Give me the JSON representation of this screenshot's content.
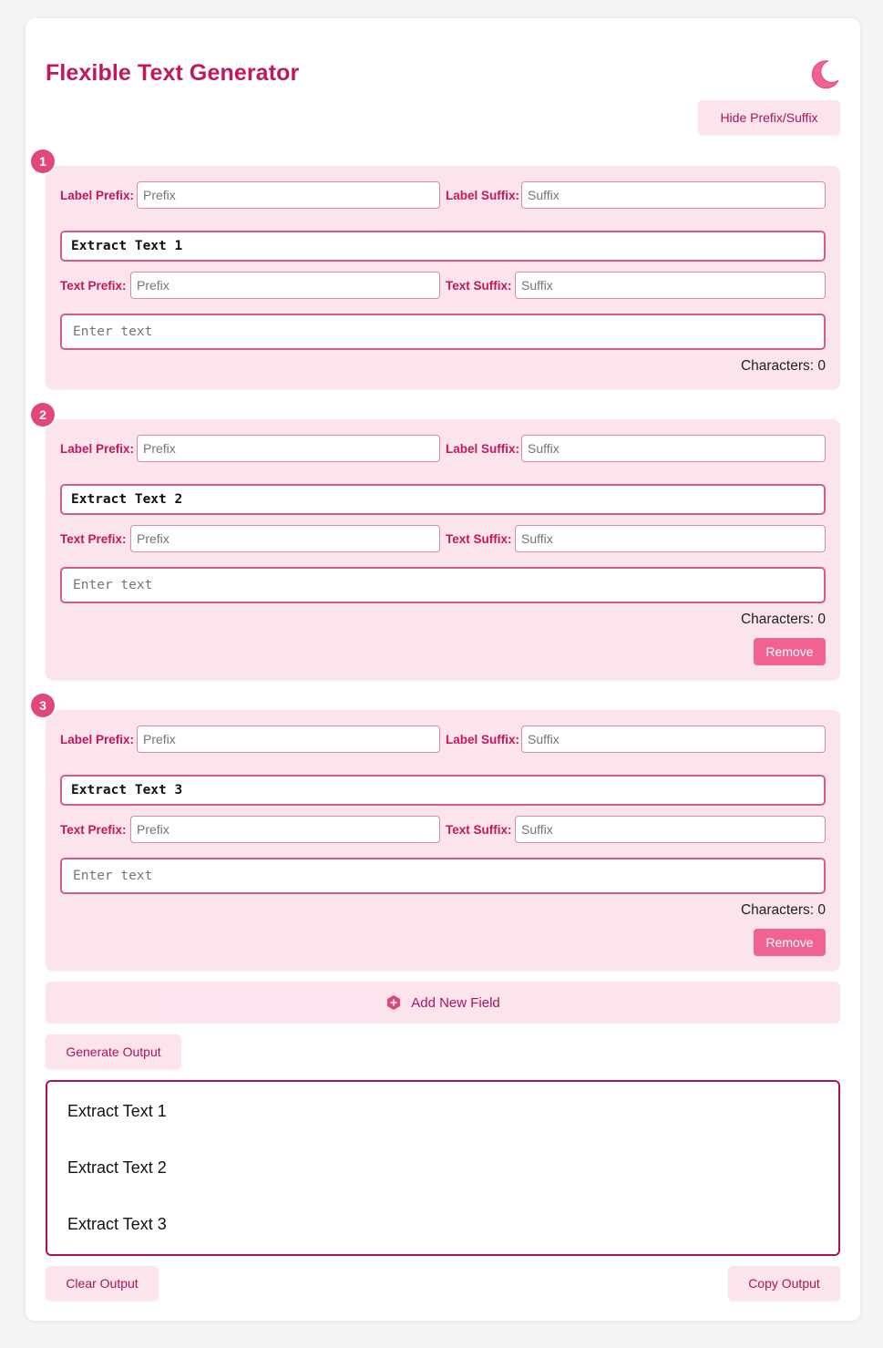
{
  "app": {
    "title": "Flexible Text Generator",
    "theme_icon": "moon-icon",
    "toggle_label": "Hide Prefix/Suffix"
  },
  "labels": {
    "label_prefix": "Label Prefix:",
    "label_suffix": "Label Suffix:",
    "text_prefix": "Text Prefix:",
    "text_suffix": "Text Suffix:",
    "prefix_placeholder": "Prefix",
    "suffix_placeholder": "Suffix",
    "text_placeholder": "Enter text",
    "remove": "Remove"
  },
  "fields": [
    {
      "number": "1",
      "label_value": "Extract Text 1",
      "char_count": "Characters: 0",
      "removable": false
    },
    {
      "number": "2",
      "label_value": "Extract Text 2",
      "char_count": "Characters: 0",
      "removable": true
    },
    {
      "number": "3",
      "label_value": "Extract Text 3",
      "char_count": "Characters: 0",
      "removable": true
    }
  ],
  "actions": {
    "add_field": "Add New Field",
    "generate": "Generate Output",
    "clear": "Clear Output",
    "copy": "Copy Output"
  },
  "output": {
    "lines": [
      "Extract Text 1",
      "Extract Text 2",
      "Extract Text 3"
    ]
  },
  "colors": {
    "accent": "#c2185b",
    "accent_light": "#fce4ec",
    "remove_button": "#f06292",
    "badge": "#e2477b"
  }
}
